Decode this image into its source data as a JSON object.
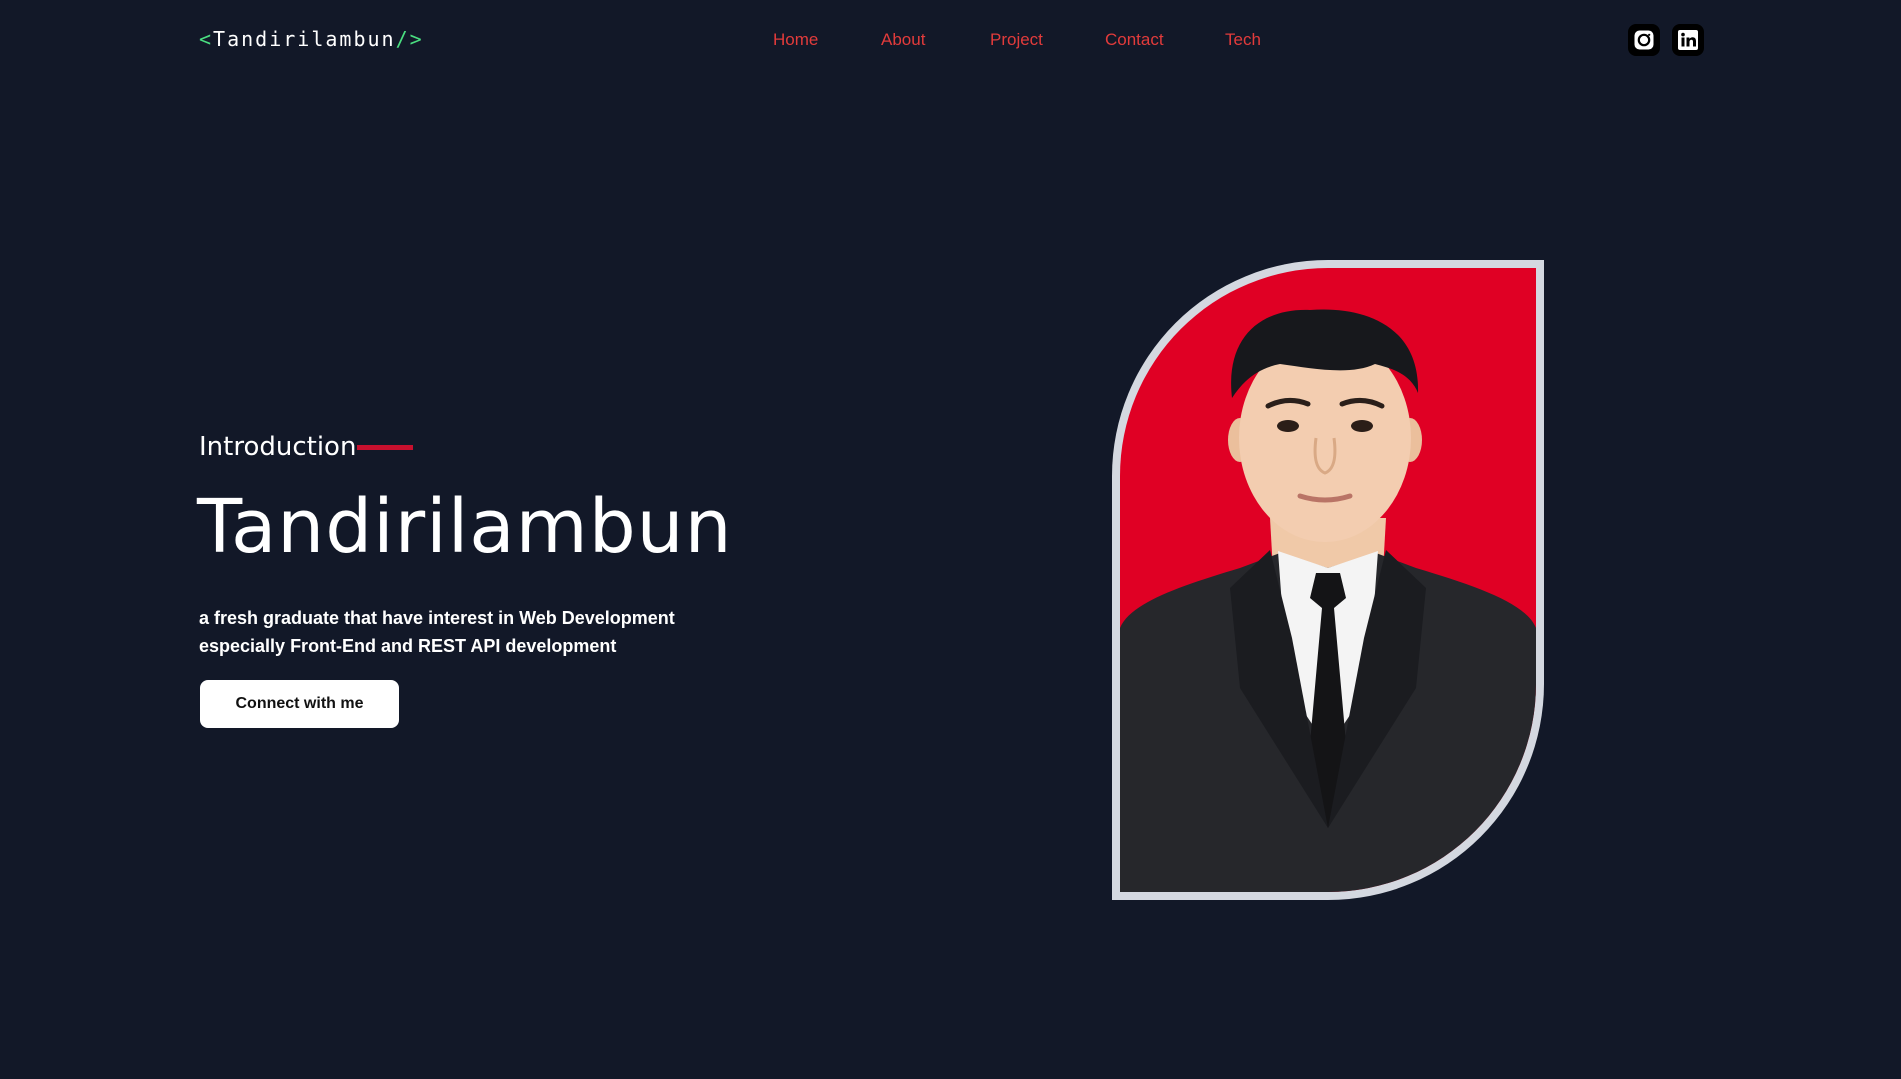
{
  "header": {
    "logo": {
      "open": "<",
      "text": "Tandirilambun",
      "close": "/>"
    },
    "nav": [
      {
        "label": "Home"
      },
      {
        "label": "About"
      },
      {
        "label": "Project"
      },
      {
        "label": "Contact"
      },
      {
        "label": "Tech"
      }
    ],
    "social": [
      {
        "icon": "instagram-icon"
      },
      {
        "icon": "linkedin-icon"
      }
    ]
  },
  "hero": {
    "intro": "Introduction",
    "name": "Tandirilambun",
    "description": [
      "a fresh graduate that have interest in Web Development",
      "especially Front-End and REST API development"
    ],
    "cta": "Connect with me"
  },
  "colors": {
    "background": "#121828",
    "accent": "#e23b3b",
    "logo_bracket": "#4ade80",
    "photo_background": "#e00024",
    "frame": "#d4d8e0"
  }
}
